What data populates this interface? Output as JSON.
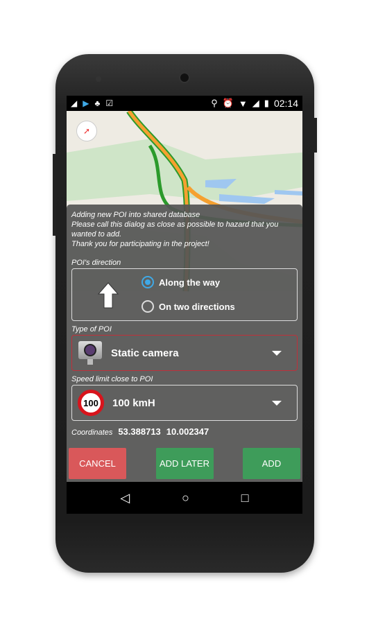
{
  "status_bar": {
    "time": "02:14",
    "icons": [
      "notification-icon",
      "play-icon",
      "android-icon",
      "clipboard-check-icon",
      "location-icon",
      "alarm-icon",
      "wifi-icon",
      "signal-icon",
      "battery-icon"
    ]
  },
  "dialog": {
    "intro": [
      "Adding new POI into shared database",
      "Please call this dialog as close as possible to hazard that you wanted to add.",
      "Thank you for participating in the project!"
    ],
    "direction_label": "POI's direction",
    "direction_options": [
      {
        "label": "Along the way",
        "selected": true
      },
      {
        "label": "On two directions",
        "selected": false
      }
    ],
    "type_label": "Type of POI",
    "type_value": "Static camera",
    "speed_label": "Speed limit close to POI",
    "speed_sign": "100",
    "speed_value": "100 kmH",
    "coords_label": "Coordinates",
    "lat": "53.388713",
    "lon": "10.002347",
    "cancel": "CANCEL",
    "add_later": "ADD LATER",
    "add": "ADD"
  },
  "colors": {
    "cancel": "#d9585a",
    "add": "#3e9c5a",
    "radio_selected": "#3fa9e6",
    "error_border": "#c0303a"
  }
}
